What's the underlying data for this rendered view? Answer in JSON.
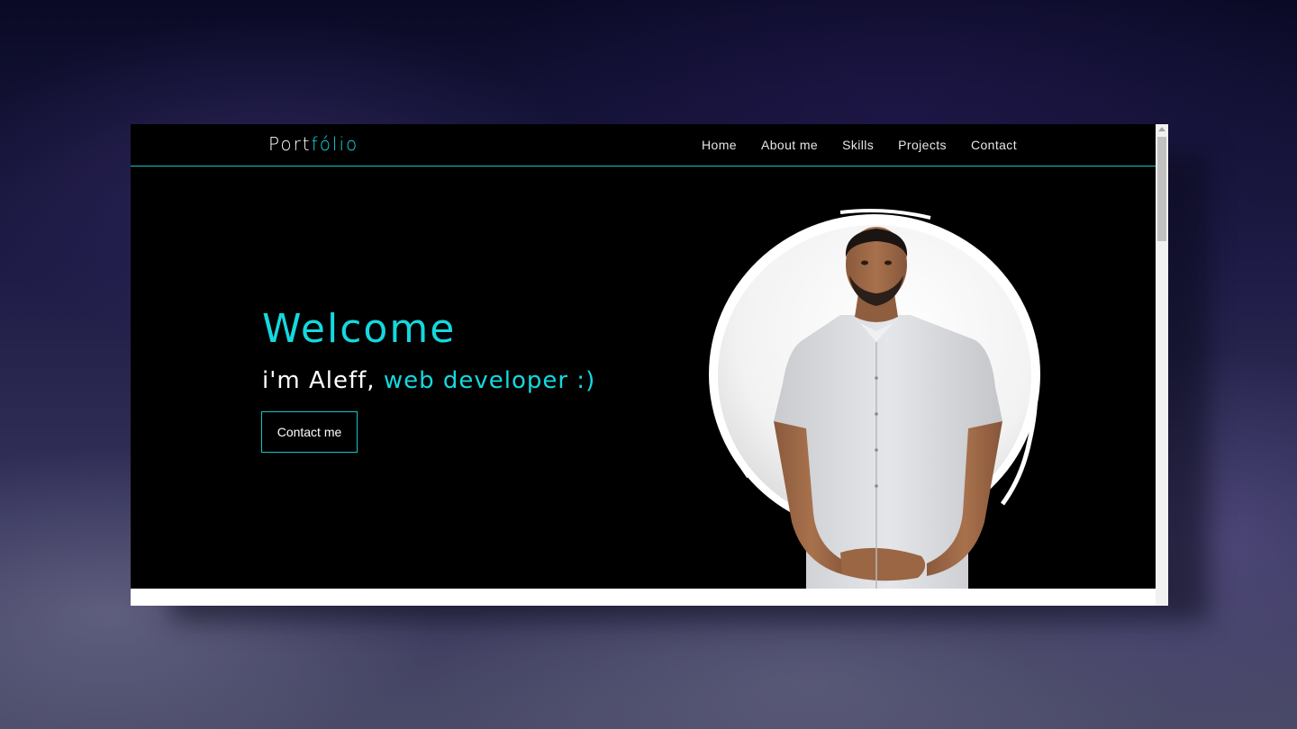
{
  "logo": {
    "part1": "Port",
    "part2": "fólio"
  },
  "nav": {
    "items": [
      "Home",
      "About me",
      "Skills",
      "Projects",
      "Contact"
    ]
  },
  "hero": {
    "welcome": "Welcome",
    "intro": "i'm Aleff, ",
    "role": "web developer :)",
    "button": "Contact me"
  },
  "colors": {
    "accent": "#14d9df",
    "background": "#000000",
    "text": "#ffffff"
  },
  "icons": {
    "portrait": "person-portrait"
  }
}
